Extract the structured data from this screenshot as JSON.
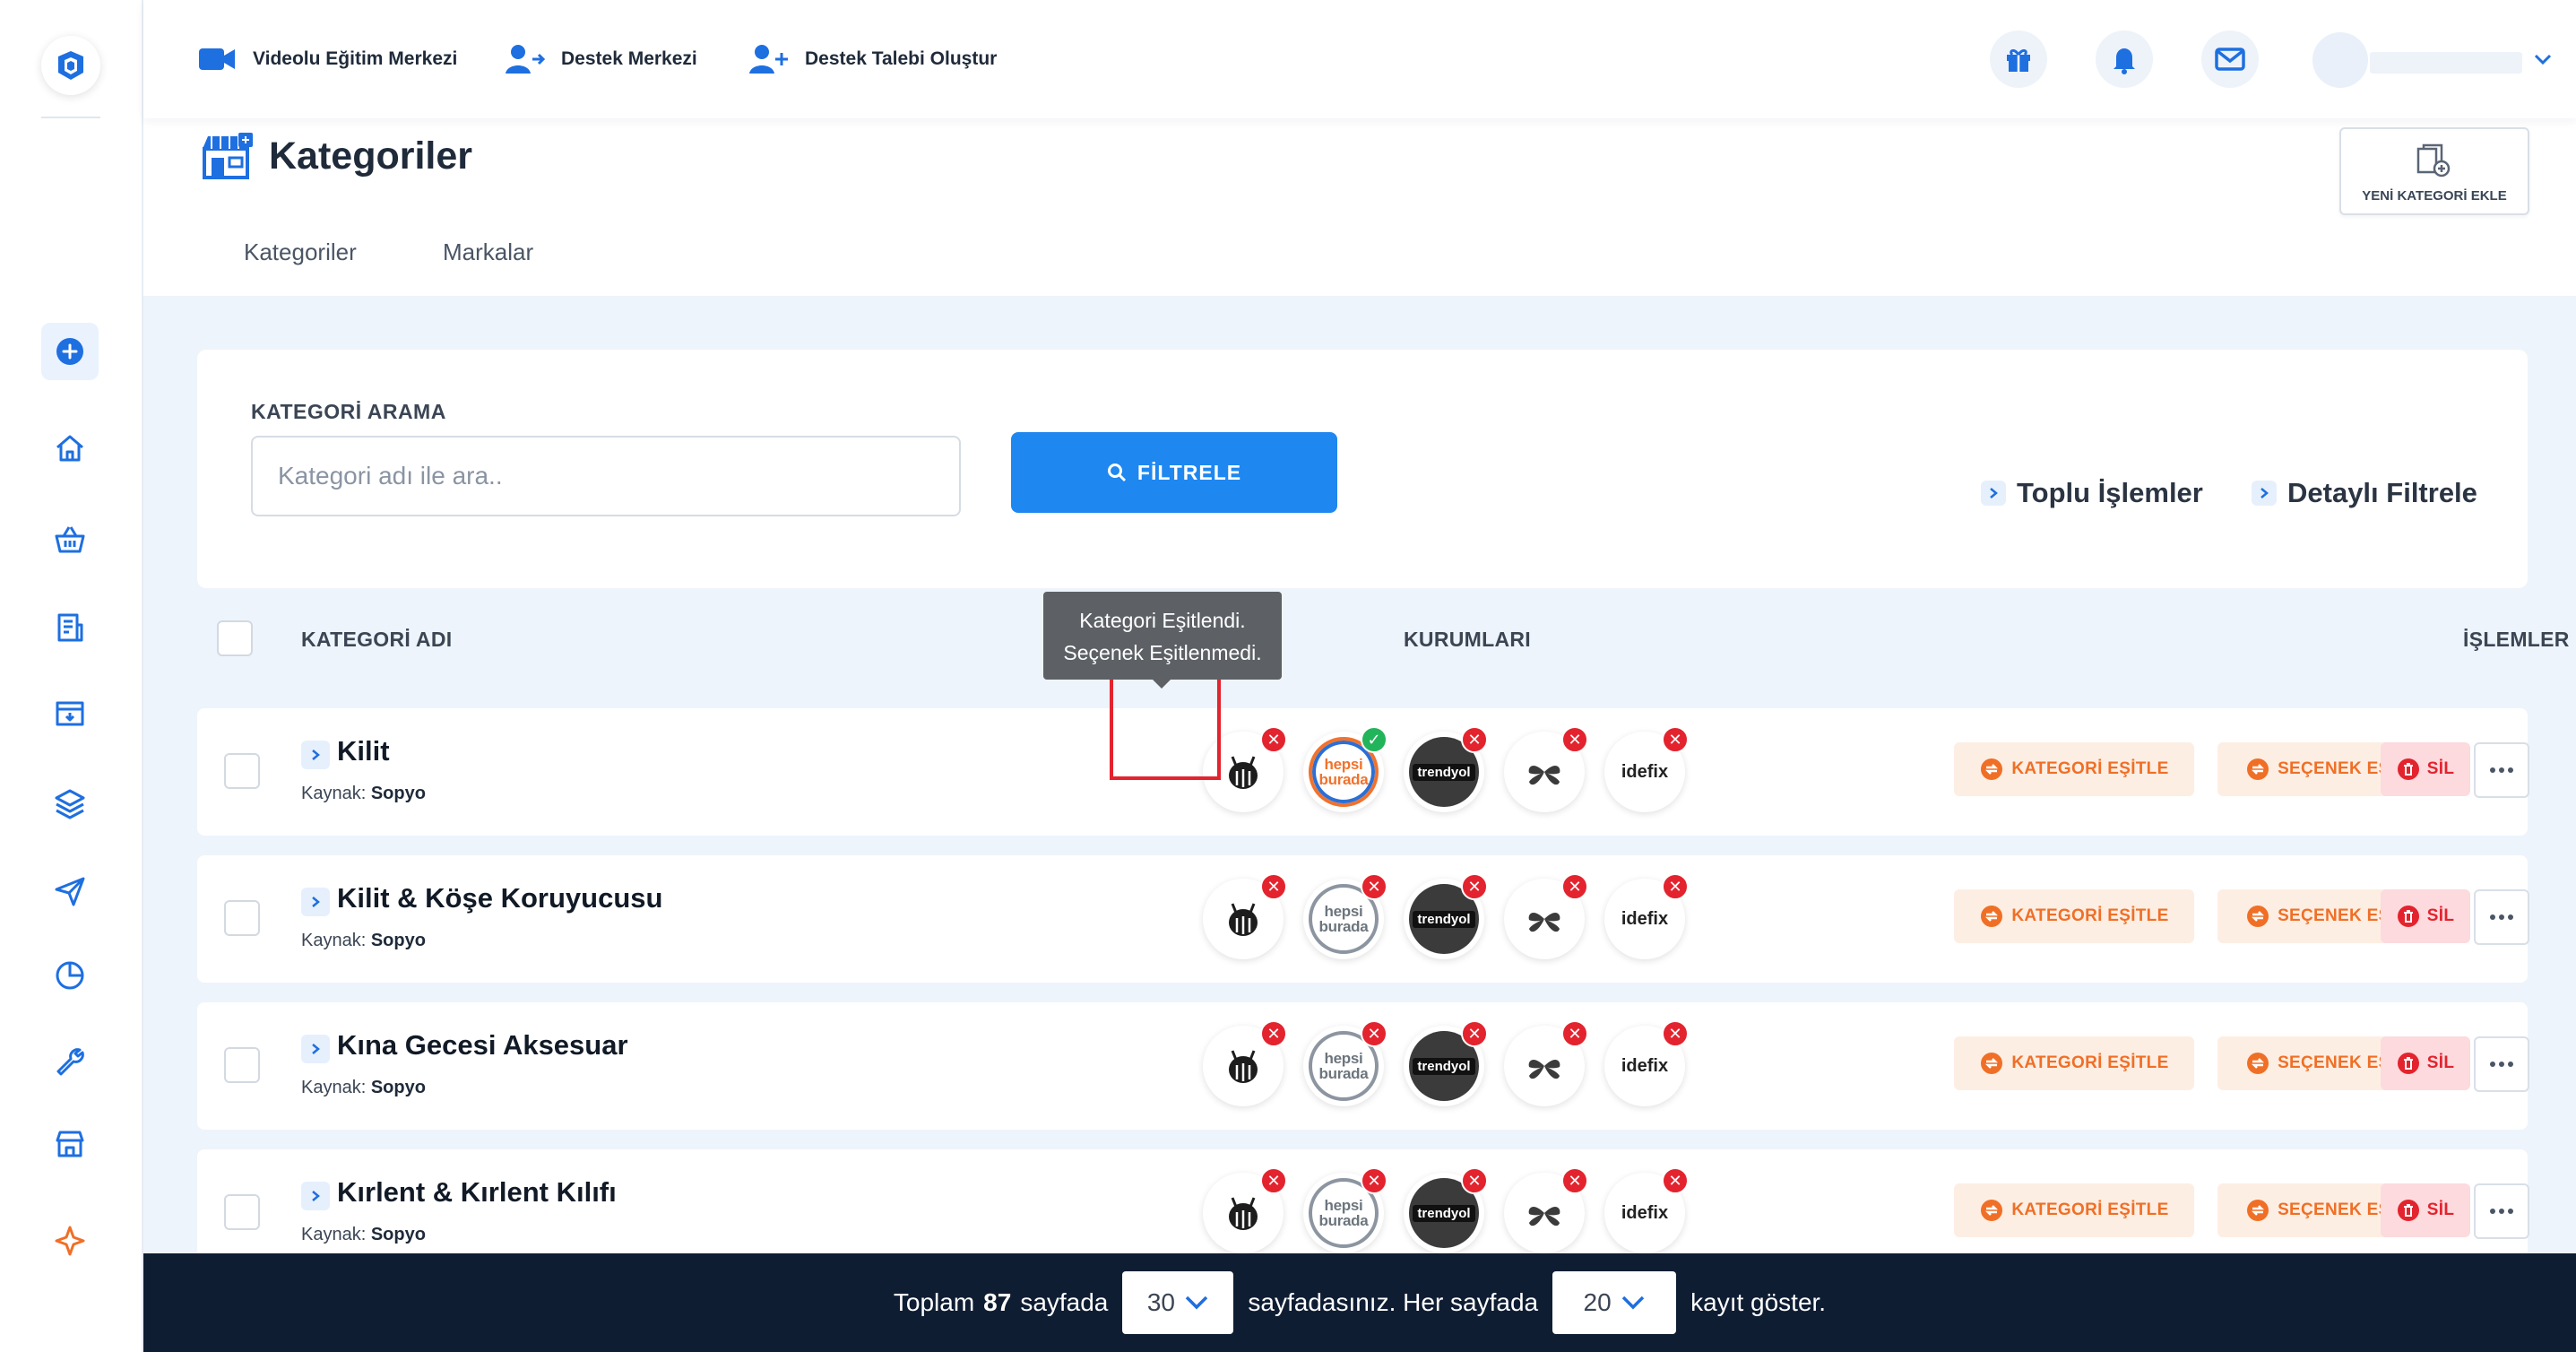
{
  "topbar": {
    "links": [
      {
        "label": "Videolu Eğitim Merkezi"
      },
      {
        "label": "Destek Merkezi"
      },
      {
        "label": "Destek Talebi Oluştur"
      }
    ]
  },
  "header": {
    "title": "Kategoriler",
    "new_category_label": "YENİ KATEGORİ EKLE",
    "tabs": [
      {
        "label": "Kategoriler"
      },
      {
        "label": "Markalar"
      }
    ]
  },
  "search": {
    "label": "KATEGORİ ARAMA",
    "placeholder": "Kategori adı ile ara..",
    "value": "",
    "filter_label": "FİLTRELE",
    "bulk_label": "Toplu İşlemler",
    "detail_label": "Detaylı Filtrele"
  },
  "table": {
    "col_name": "KATEGORİ ADI",
    "col_marketplaces": "KURUMLARI",
    "col_actions": "İŞLEMLER",
    "source_prefix": "Kaynak:",
    "rows": [
      {
        "name": "Kilit",
        "source": "Sopyo",
        "hb_matched": true
      },
      {
        "name": "Kilit & Köşe Koruyucusu",
        "source": "Sopyo",
        "hb_matched": false
      },
      {
        "name": "Kına Gecesi Aksesuar",
        "source": "Sopyo",
        "hb_matched": false
      },
      {
        "name": "Kırlent & Kırlent Kılıfı",
        "source": "Sopyo",
        "hb_matched": false
      }
    ],
    "marketplace_labels": {
      "hepsiburada_top": "hepsi",
      "hepsiburada_bottom": "burada",
      "trendyol": "trendyol",
      "idefix": "idefix"
    },
    "actions": {
      "match_category": "KATEGORİ EŞİTLE",
      "match_option": "SEÇENEK EŞİTLE",
      "delete": "SİL"
    }
  },
  "tooltip": {
    "line1": "Kategori Eşitlendi.",
    "line2": "Seçenek Eşitlenmedi."
  },
  "pager": {
    "text_total": "Toplam",
    "total_pages": "87",
    "text_pages_at": "sayfada",
    "current_page": "30",
    "text_per_page": "sayfadasınız. Her sayfada",
    "per_page": "20",
    "text_show": "kayıt göster."
  },
  "colors": {
    "primary": "#1e87f0",
    "orange": "#f06f26",
    "danger": "#e3232e",
    "success": "#22b45a",
    "footer": "#0f1d33"
  }
}
